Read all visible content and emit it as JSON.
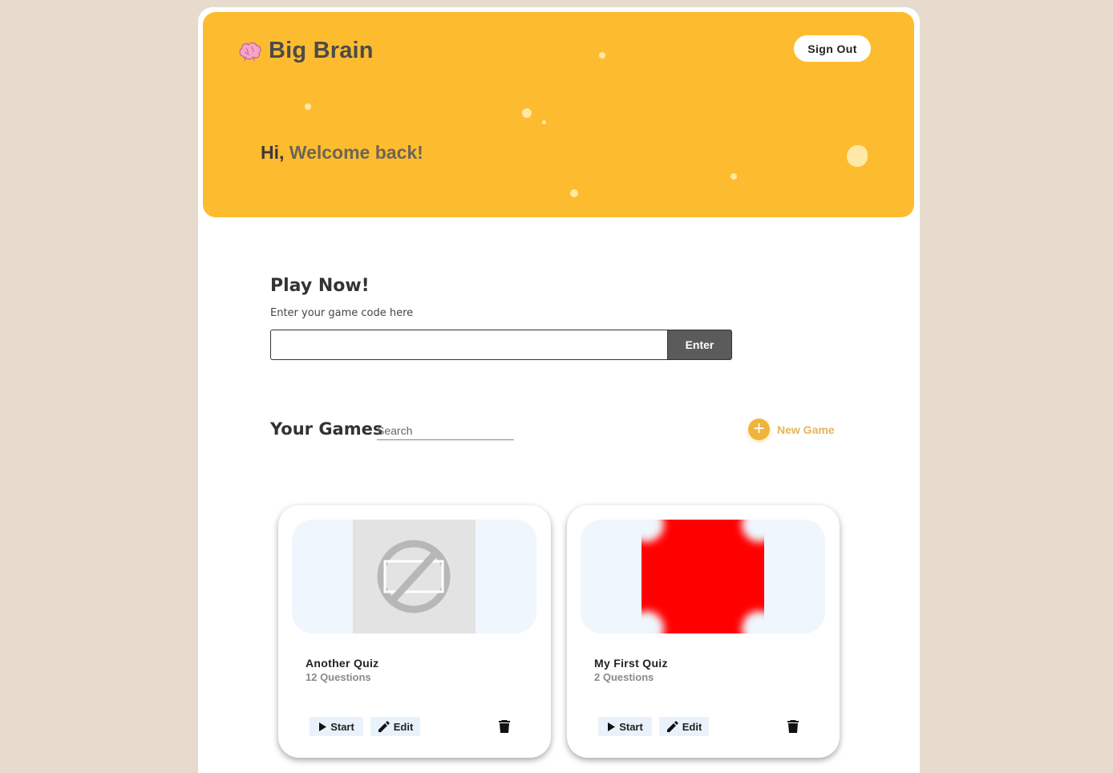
{
  "header": {
    "brand": "Big Brain",
    "brand_icon": "brain-icon",
    "signout_label": "Sign Out",
    "greeting_hi": "Hi,",
    "greeting_message": "Welcome back!"
  },
  "play": {
    "title": "Play Now!",
    "subtitle": "Enter your game code here",
    "code_value": "",
    "enter_label": "Enter"
  },
  "games": {
    "title": "Your Games",
    "search_placeholder": "Search",
    "new_game_label": "New Game",
    "items": [
      {
        "title": "Another Quiz",
        "questions": "12 Questions",
        "start_label": "Start",
        "edit_label": "Edit",
        "thumbnail": "placeholder-image"
      },
      {
        "title": "My First Quiz",
        "questions": "2 Questions",
        "start_label": "Start",
        "edit_label": "Edit",
        "thumbnail": "red-image"
      }
    ]
  },
  "colors": {
    "page_bg": "#e6dbcd",
    "hero_bg": "#fdbc2f",
    "accent": "#f0b43c",
    "enter_bg": "#5b5b5b",
    "card_btn_bg": "#e9f2fb"
  }
}
